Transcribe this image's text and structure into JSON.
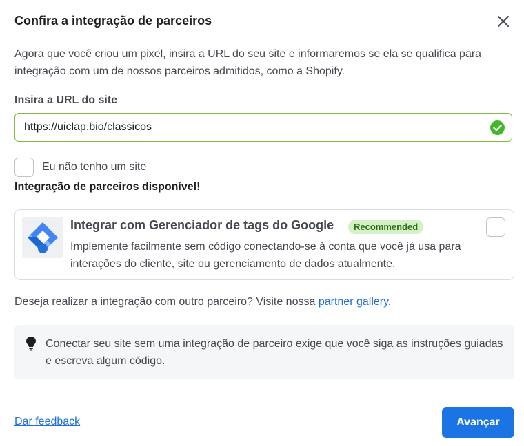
{
  "dialog": {
    "title": "Confira a integração de parceiros",
    "intro": "Agora que você criou um pixel, insira a URL do seu site e informaremos se ela se qualifica para integração com um de nossos parceiros admitidos, como a Shopify."
  },
  "url_field": {
    "label": "Insira a URL do site",
    "value": "https://uiclap.bio/classicos",
    "status_icon": "check-circle-icon",
    "status_color": "#42b72a"
  },
  "no_site": {
    "label": "Eu não tenho um site",
    "checked": false
  },
  "partners": {
    "heading": "Integração de parceiros disponível!",
    "items": [
      {
        "icon": "google-tag-manager-logo",
        "title": "Integrar com Gerenciador de tags do Google",
        "badge": "Recommended",
        "description": "Implemente facilmente sem código conectando-se à conta que você já usa para interações do cliente, site ou gerenciamento de dados atualmente,",
        "checked": false
      }
    ]
  },
  "other_partner": {
    "text": "Deseja realizar a integração com outro parceiro? Visite nossa ",
    "link": "partner gallery",
    "suffix": "."
  },
  "info": {
    "icon": "lightbulb-icon",
    "text": "Conectar seu site sem uma integração de parceiro exige que você siga as instruções guiadas e escreva algum código."
  },
  "footer": {
    "feedback": "Dar feedback",
    "next": "Avançar"
  },
  "colors": {
    "accent": "#1b74e4",
    "link": "#216fdb",
    "success": "#42b72a",
    "badge_bg": "#d4f0c4"
  }
}
